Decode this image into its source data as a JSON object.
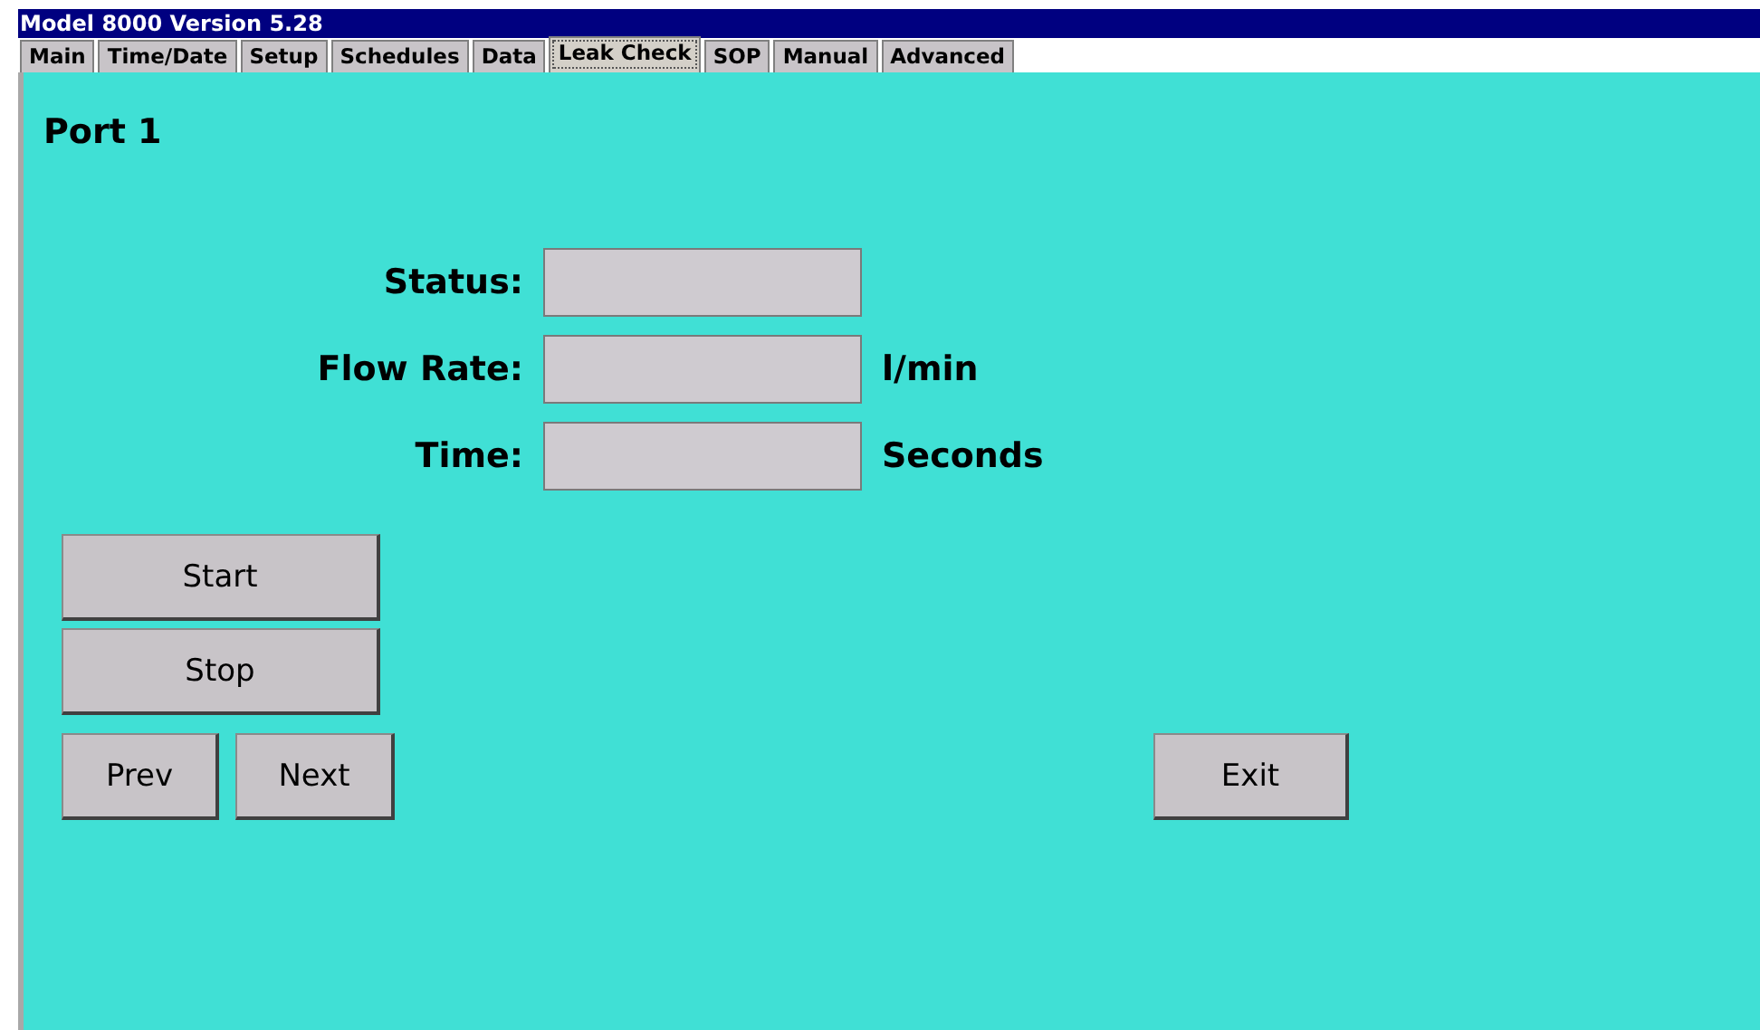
{
  "window": {
    "title": "Model 8000 Version 5.28"
  },
  "tabs": [
    {
      "label": "Main",
      "selected": false
    },
    {
      "label": "Time/Date",
      "selected": false
    },
    {
      "label": "Setup",
      "selected": false
    },
    {
      "label": "Schedules",
      "selected": false
    },
    {
      "label": "Data",
      "selected": false
    },
    {
      "label": "Leak Check",
      "selected": true
    },
    {
      "label": "SOP",
      "selected": false
    },
    {
      "label": "Manual",
      "selected": false
    },
    {
      "label": "Advanced",
      "selected": false
    }
  ],
  "heading": "Port 1",
  "fields": [
    {
      "label": "Status:"
    },
    {
      "label": "Flow Rate:",
      "unit": "l/min"
    },
    {
      "label": "Time:",
      "unit": "Seconds"
    }
  ],
  "buttons": {
    "start": "Start",
    "stop": "Stop",
    "prev": "Prev",
    "next": "Next",
    "exit": "Exit"
  }
}
